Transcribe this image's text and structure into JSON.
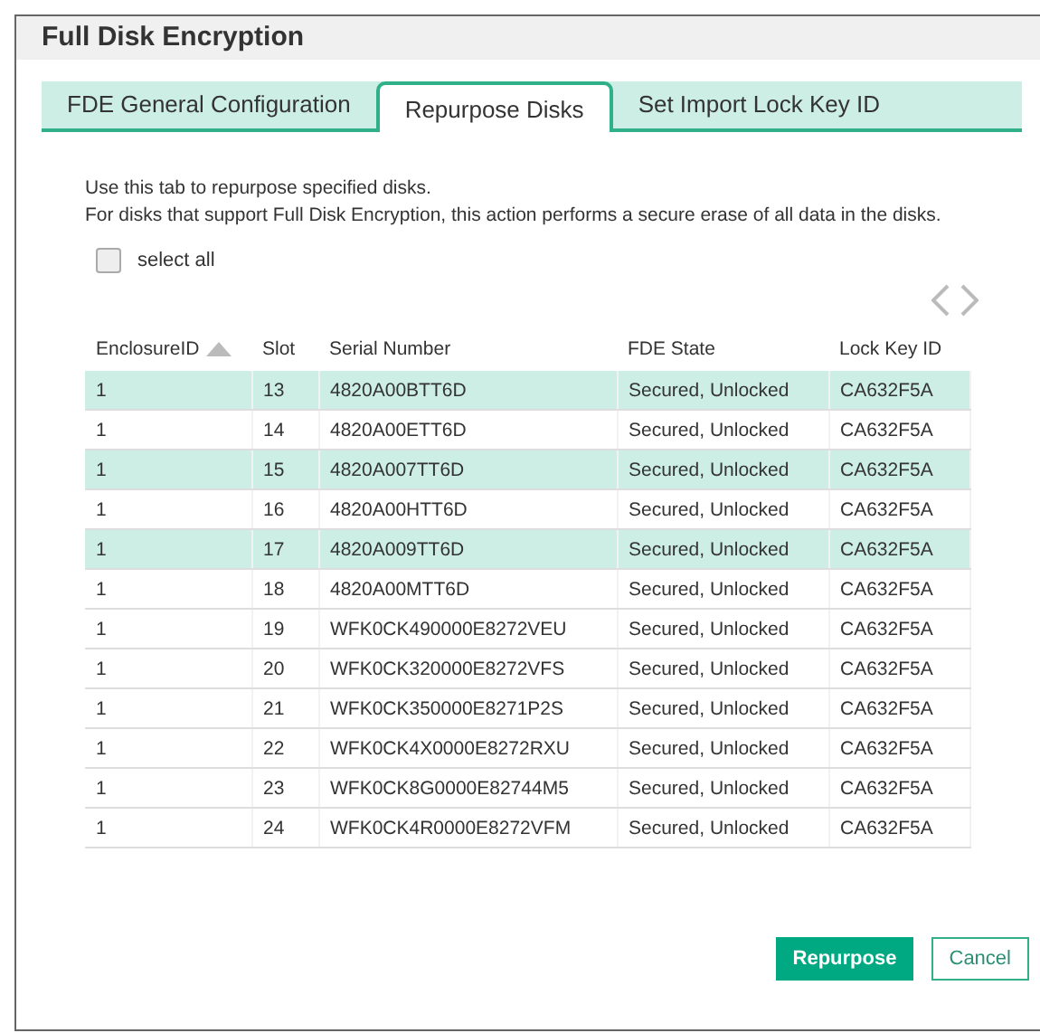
{
  "window": {
    "title": "Full Disk Encryption"
  },
  "tabs": [
    {
      "label": "FDE General Configuration",
      "selected": false
    },
    {
      "label": "Repurpose Disks",
      "selected": true
    },
    {
      "label": "Set Import Lock Key ID",
      "selected": false
    }
  ],
  "description": [
    "Use this tab to repurpose specified disks.",
    "For disks that support Full Disk Encryption, this action performs a secure erase of all data in the disks."
  ],
  "select_all": {
    "label": "select all",
    "checked": false
  },
  "table": {
    "columns": [
      {
        "label": "EnclosureID",
        "sorted": true
      },
      {
        "label": "Slot",
        "sorted": false
      },
      {
        "label": "Serial Number",
        "sorted": false
      },
      {
        "label": "FDE State",
        "sorted": false
      },
      {
        "label": "Lock Key ID",
        "sorted": false
      }
    ],
    "rows": [
      {
        "cells": [
          "1",
          "13",
          "4820A00BTT6D",
          "Secured, Unlocked",
          "CA632F5A"
        ],
        "selected": true
      },
      {
        "cells": [
          "1",
          "14",
          "4820A00ETT6D",
          "Secured, Unlocked",
          "CA632F5A"
        ],
        "selected": false
      },
      {
        "cells": [
          "1",
          "15",
          "4820A007TT6D",
          "Secured, Unlocked",
          "CA632F5A"
        ],
        "selected": true
      },
      {
        "cells": [
          "1",
          "16",
          "4820A00HTT6D",
          "Secured, Unlocked",
          "CA632F5A"
        ],
        "selected": false
      },
      {
        "cells": [
          "1",
          "17",
          "4820A009TT6D",
          "Secured, Unlocked",
          "CA632F5A"
        ],
        "selected": true
      },
      {
        "cells": [
          "1",
          "18",
          "4820A00MTT6D",
          "Secured, Unlocked",
          "CA632F5A"
        ],
        "selected": false
      },
      {
        "cells": [
          "1",
          "19",
          "WFK0CK490000E8272VEU",
          "Secured, Unlocked",
          "CA632F5A"
        ],
        "selected": false
      },
      {
        "cells": [
          "1",
          "20",
          "WFK0CK320000E8272VFS",
          "Secured, Unlocked",
          "CA632F5A"
        ],
        "selected": false
      },
      {
        "cells": [
          "1",
          "21",
          "WFK0CK350000E8271P2S",
          "Secured, Unlocked",
          "CA632F5A"
        ],
        "selected": false
      },
      {
        "cells": [
          "1",
          "22",
          "WFK0CK4X0000E8272RXU",
          "Secured, Unlocked",
          "CA632F5A"
        ],
        "selected": false
      },
      {
        "cells": [
          "1",
          "23",
          "WFK0CK8G0000E82744M5",
          "Secured, Unlocked",
          "CA632F5A"
        ],
        "selected": false
      },
      {
        "cells": [
          "1",
          "24",
          "WFK0CK4R0000E8272VFM",
          "Secured, Unlocked",
          "CA632F5A"
        ],
        "selected": false
      }
    ]
  },
  "buttons": [
    {
      "label": "Repurpose",
      "kind": "primary"
    },
    {
      "label": "Cancel",
      "kind": "secondary"
    }
  ]
}
